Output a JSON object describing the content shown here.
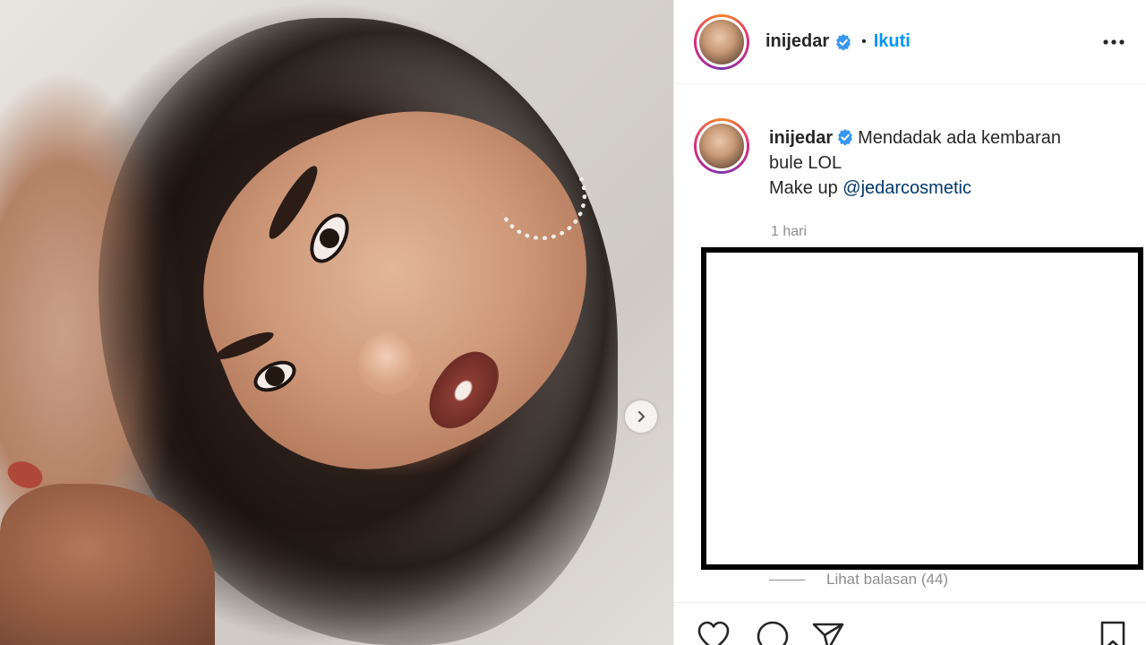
{
  "post": {
    "username": "inijedar",
    "follow_label": "Ikuti",
    "separator": "•"
  },
  "caption": {
    "username": "inijedar",
    "line1": "Mendadak ada kembaran",
    "line2": "bule LOL",
    "line3_prefix": "Make up ",
    "mention": "@jedarcosmetic",
    "time": "1 hari"
  },
  "comments": {
    "view_replies": "Lihat balasan (44)"
  },
  "icons": [
    "verified-badge-icon",
    "more-options-icon",
    "chevron-right-icon",
    "heart-icon",
    "comment-icon",
    "share-icon",
    "bookmark-icon"
  ],
  "colors": {
    "accent": "#0095f6",
    "verified": "#3897f0",
    "text": "#262626",
    "muted": "#8e8e8e"
  }
}
